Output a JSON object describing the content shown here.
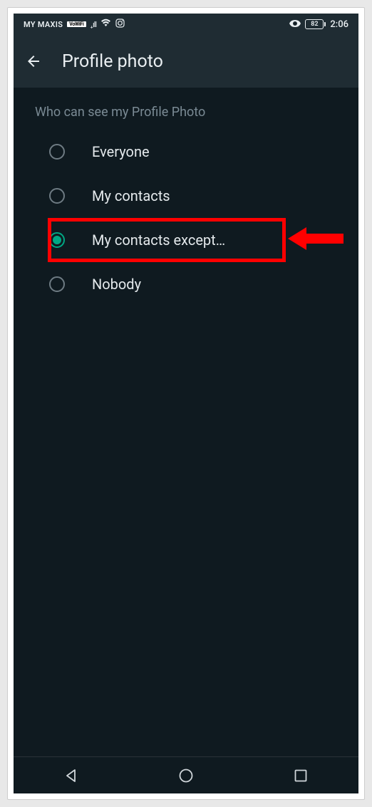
{
  "status": {
    "carrier": "MY MAXIS",
    "vowifi": "VoWiFi",
    "battery": "82",
    "time": "2:06"
  },
  "header": {
    "title": "Profile photo"
  },
  "section": {
    "label": "Who can see my Profile Photo"
  },
  "options": [
    {
      "label": "Everyone",
      "selected": false
    },
    {
      "label": "My contacts",
      "selected": false
    },
    {
      "label": "My contacts except…",
      "selected": true
    },
    {
      "label": "Nobody",
      "selected": false
    }
  ]
}
